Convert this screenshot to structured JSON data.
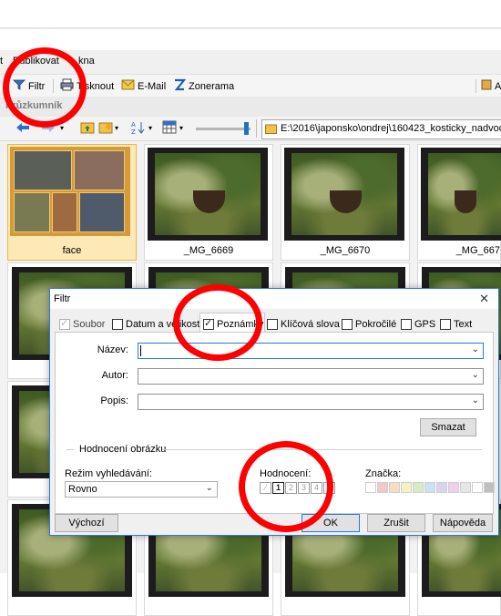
{
  "menu": [
    "t",
    "Publikovat",
    "kna"
  ],
  "toolbar": {
    "filter": "Filtr",
    "print": "Tisknout",
    "email": "E-Mail",
    "zonerama": "Zonerama",
    "right_partial": "A"
  },
  "section_label": "Průzkumník",
  "address": "E:\\2016\\japonsko\\ondrej\\160423_kosticky_nadvodou",
  "thumbs": [
    {
      "caption": "face"
    },
    {
      "caption": "_MG_6669"
    },
    {
      "caption": "_MG_6670"
    },
    {
      "caption": "_MG_667"
    }
  ],
  "dialog": {
    "title": "Filtr",
    "close": "✕",
    "tabs": [
      {
        "label": "Soubor",
        "state": "disabled"
      },
      {
        "label": "Datum a velikost",
        "state": "off"
      },
      {
        "label": "Poznámky",
        "state": "on"
      },
      {
        "label": "Klíčová slova",
        "state": "off"
      },
      {
        "label": "Pokročilé",
        "state": "off"
      },
      {
        "label": "GPS",
        "state": "off"
      },
      {
        "label": "Text",
        "state": "off"
      }
    ],
    "fields": {
      "name_label": "Název:",
      "author_label": "Autor:",
      "desc_label": "Popis:"
    },
    "clear_button": "Smazat",
    "rating_section": "Hodnocení obrázku",
    "search_mode_label": "Režim vyhledávání:",
    "search_mode_value": "Rovno",
    "rating_label": "Hodnocení:",
    "rating_stars": [
      "1",
      "2",
      "3",
      "4",
      "5"
    ],
    "rating_selected": "1",
    "tag_label": "Značka:",
    "tag_colors": [
      "#ffffff",
      "#f2c8c8",
      "#f7dcc0",
      "#f5f2c2",
      "#d5ecc7",
      "#c9e2f2",
      "#d9d3f0",
      "#ecd0ec",
      "#e6e6e6",
      "#ffffff",
      "#bfbfbf"
    ],
    "buttons": {
      "default": "Výchozí",
      "ok": "OK",
      "cancel": "Zrušit",
      "help": "Nápověda"
    }
  },
  "annotation_color": "#ff0000"
}
